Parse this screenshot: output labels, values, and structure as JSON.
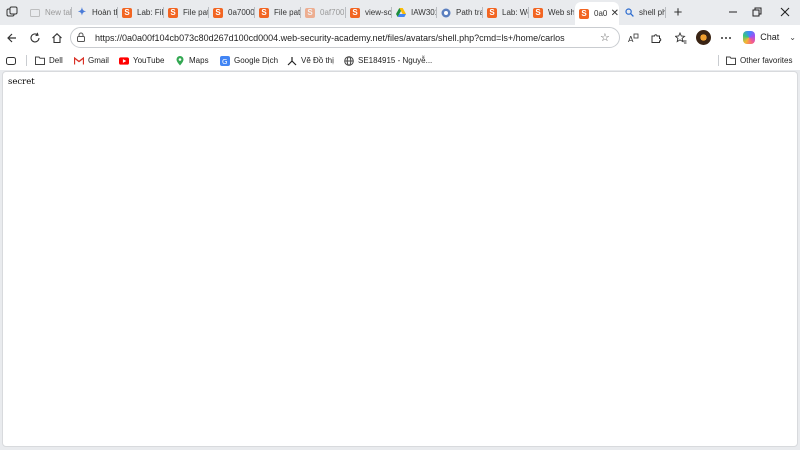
{
  "tabs": [
    {
      "title": "New tab",
      "favicon": "new-tab-icon",
      "state": "dim"
    },
    {
      "title": "Hoàn th",
      "favicon": "copilot-sparkle-icon",
      "state": "normal"
    },
    {
      "title": "Lab: File",
      "favicon": "portswigger-icon",
      "state": "normal"
    },
    {
      "title": "File path",
      "favicon": "portswigger-icon",
      "state": "normal"
    },
    {
      "title": "0a7000",
      "favicon": "portswigger-icon",
      "state": "normal"
    },
    {
      "title": "File path",
      "favicon": "portswigger-icon",
      "state": "normal"
    },
    {
      "title": "0af700",
      "favicon": "portswigger-icon",
      "state": "dim"
    },
    {
      "title": "view-so",
      "favicon": "portswigger-icon",
      "state": "normal"
    },
    {
      "title": "IAW301",
      "favicon": "drive-icon",
      "state": "normal"
    },
    {
      "title": "Path tra",
      "favicon": "cloud-icon",
      "state": "normal"
    },
    {
      "title": "Lab: We",
      "favicon": "portswigger-icon",
      "state": "normal"
    },
    {
      "title": "Web sh",
      "favicon": "portswigger-icon",
      "state": "normal"
    },
    {
      "title": "0a0",
      "favicon": "portswigger-icon",
      "state": "active"
    },
    {
      "title": "shell ph",
      "favicon": "search-icon",
      "state": "normal"
    }
  ],
  "toolbar": {
    "url": "https://0a0a00f104cb073c80d267d100cd0004.web-security-academy.net/files/avatars/shell.php?cmd=ls+/home/carlos",
    "chat_label": "Chat"
  },
  "bookmarks": {
    "items": [
      {
        "label": "Dell",
        "icon": "folder-icon"
      },
      {
        "label": "Gmail",
        "icon": "gmail-icon"
      },
      {
        "label": "YouTube",
        "icon": "youtube-icon"
      },
      {
        "label": "Maps",
        "icon": "maps-icon"
      },
      {
        "label": "Google Dịch",
        "icon": "google-translate-icon"
      },
      {
        "label": "Vẽ Đồ thị",
        "icon": "graph-icon"
      },
      {
        "label": "SE184915 - Nguyễ...",
        "icon": "globe-icon"
      }
    ],
    "other_label": "Other favorites"
  },
  "page": {
    "output": "secret"
  },
  "colors": {
    "portswigger": "#f26522",
    "chrome_bg": "#e9ebee",
    "content_bg": "#ffffff"
  }
}
